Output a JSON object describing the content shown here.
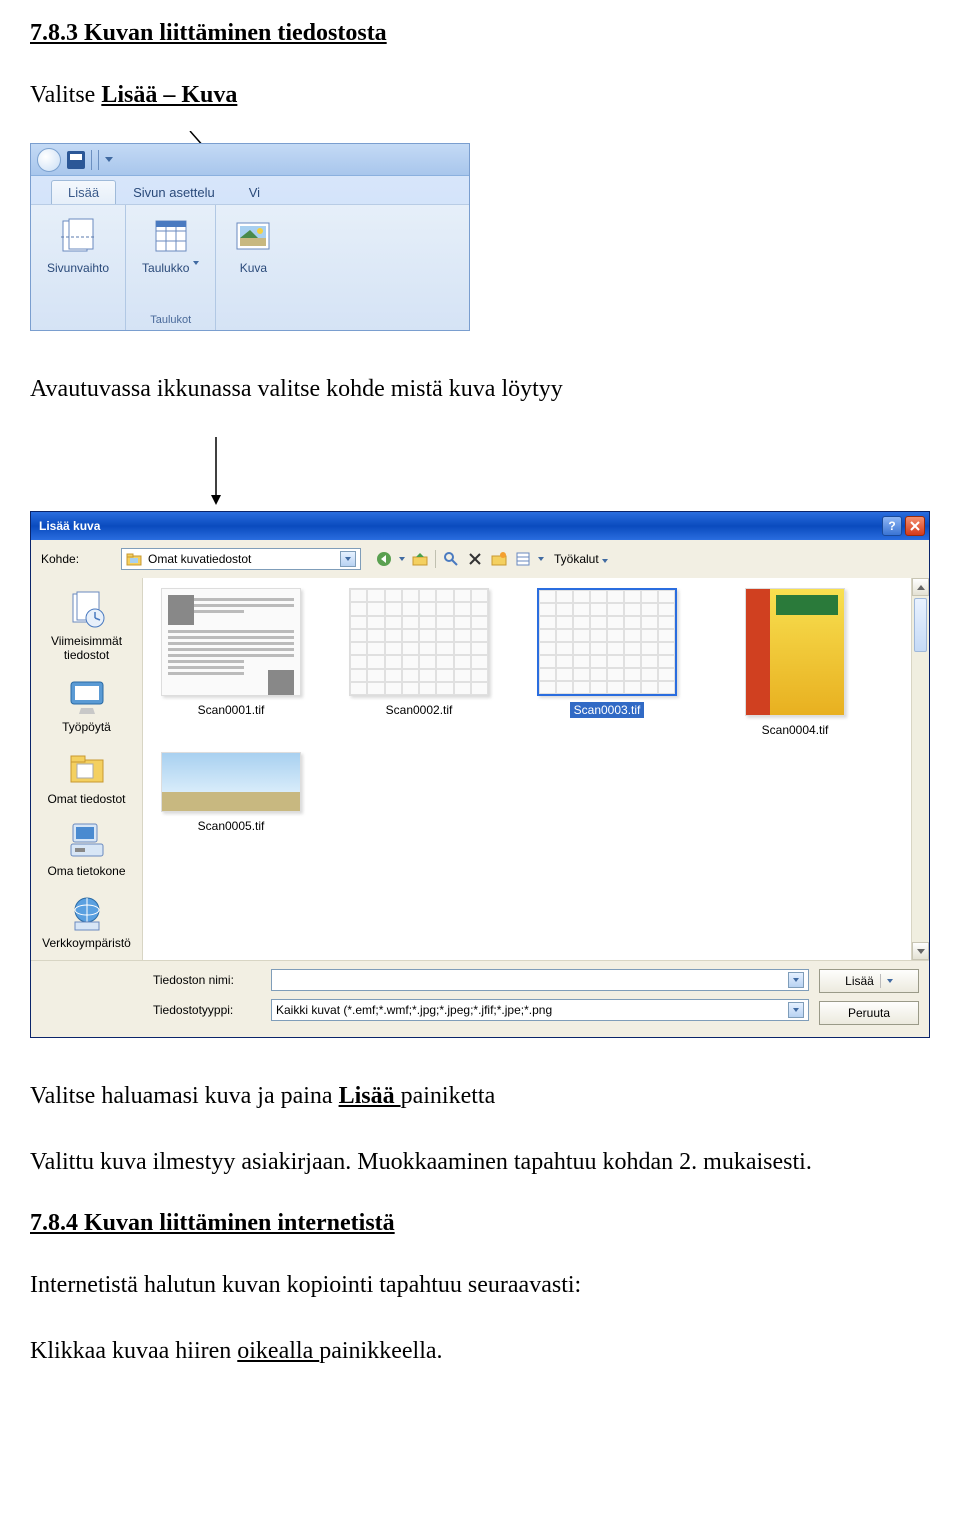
{
  "headings": {
    "h783": "7.8.3 Kuvan liittäminen tiedostosta",
    "h784": "7.8.4 Kuvan liittäminen internetistä"
  },
  "text": {
    "p1_pre": "Valitse ",
    "p1_link": "Lisää – Kuva",
    "p2": "Avautuvassa ikkunassa valitse kohde mistä kuva löytyy",
    "p3_pre": "Valitse haluamasi kuva ja paina ",
    "p3_link": "Lisää ",
    "p3_post": "painiketta",
    "p4": "Valittu kuva ilmestyy asiakirjaan. Muokkaaminen tapahtuu kohdan 2. mukaisesti.",
    "p5": "Internetistä halutun kuvan kopiointi tapahtuu seuraavasti:",
    "p6_pre": "Klikkaa kuvaa hiiren ",
    "p6_link": "oikealla ",
    "p6_post": "painikkeella."
  },
  "ribbon": {
    "tabs": {
      "active": "Lisää",
      "t2": "Sivun asettelu",
      "t3": "Vi"
    },
    "btn_pagebreak": "Sivunvaihto",
    "btn_table": "Taulukko",
    "btn_picture": "Kuva",
    "group_tables": "Taulukot"
  },
  "dialog": {
    "title": "Lisää kuva",
    "kohde_label": "Kohde:",
    "kohde_value": "Omat kuvatiedostot",
    "tools_label": "Työkalut",
    "places": {
      "recent": "Viimeisimmät tiedostot",
      "desktop": "Työpöytä",
      "mydocs": "Omat tiedostot",
      "mycomp": "Oma tietokone",
      "network": "Verkkoympäristö"
    },
    "files": {
      "f1": "Scan0001.tif",
      "f2": "Scan0002.tif",
      "f3": "Scan0003.tif",
      "f4": "Scan0004.tif",
      "f5": "Scan0005.tif"
    },
    "filename_label": "Tiedoston nimi:",
    "filename_value": "",
    "filetype_label": "Tiedostotyyppi:",
    "filetype_value": "Kaikki kuvat (*.emf;*.wmf;*.jpg;*.jpeg;*.jfif;*.jpe;*.png",
    "btn_insert": "Lisää",
    "btn_cancel": "Peruuta"
  }
}
